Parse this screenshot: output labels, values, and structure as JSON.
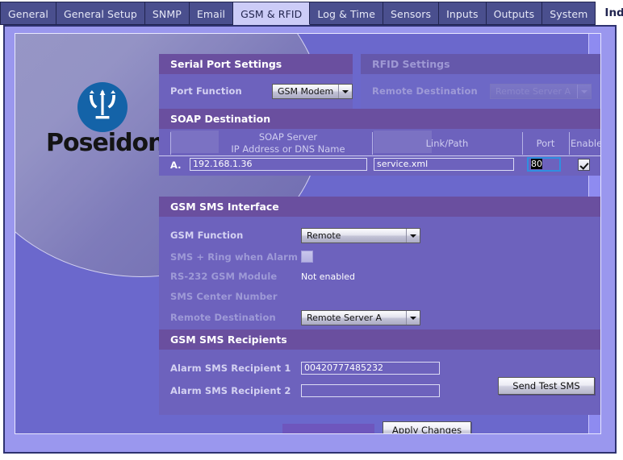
{
  "tabs": [
    {
      "label": "General",
      "active": false
    },
    {
      "label": "General Setup",
      "active": false
    },
    {
      "label": "SNMP",
      "active": false
    },
    {
      "label": "Email",
      "active": false
    },
    {
      "label": "GSM & RFID",
      "active": true
    },
    {
      "label": "Log & Time",
      "active": false
    },
    {
      "label": "Sensors",
      "active": false
    },
    {
      "label": "Inputs",
      "active": false
    },
    {
      "label": "Outputs",
      "active": false
    },
    {
      "label": "System",
      "active": false
    }
  ],
  "index_page_label": "Index Page",
  "logo": {
    "wordmark": "Poseidon",
    "icon": "trident-icon"
  },
  "serial_port": {
    "title": "Serial Port Settings",
    "port_function_label": "Port Function",
    "port_function_value": "GSM Modem"
  },
  "rfid": {
    "title": "RFID Settings",
    "remote_destination_label": "Remote Destination",
    "remote_destination_value": "Remote Server A",
    "disabled": true
  },
  "soap": {
    "title": "SOAP Destination",
    "columns": {
      "server_line1": "SOAP Server",
      "server_line2": "IP Address or DNS Name",
      "link": "Link/Path",
      "port": "Port",
      "enable": "Enable"
    },
    "rows": [
      {
        "index": "A.",
        "server": "192.168.1.36",
        "link": "service.xml",
        "port": "80",
        "enabled": true
      }
    ]
  },
  "gsm_sms": {
    "title": "GSM SMS Interface",
    "gsm_function_label": "GSM Function",
    "gsm_function_value": "Remote",
    "sms_ring_label": "SMS + Ring when Alarm",
    "sms_ring_checked": false,
    "module_label": "RS-232 GSM Module",
    "module_value": "Not enabled",
    "center_number_label": "SMS Center Number",
    "center_number_value": "",
    "remote_dest_label": "Remote Destination",
    "remote_dest_value": "Remote Server A"
  },
  "recipients": {
    "title": "GSM SMS Recipients",
    "recipient1_label": "Alarm SMS Recipient 1",
    "recipient1_value": "00420777485232",
    "recipient2_label": "Alarm SMS Recipient 2",
    "recipient2_value": "",
    "send_test_label": "Send Test SMS"
  },
  "footer": {
    "apply_label": "Apply Changes",
    "status_text": ""
  },
  "colors": {
    "tab_inactive_bg": "#4a4f8e",
    "tab_active_bg": "#ccccf7",
    "panel_bg": "#6b68cc",
    "section_head_bg": "#6a4f9f",
    "section_body_bg": "#6d62bd",
    "logo_circle": "#1463a8",
    "focus_border": "#2f8fe0",
    "frame_border": "#2e3270"
  }
}
